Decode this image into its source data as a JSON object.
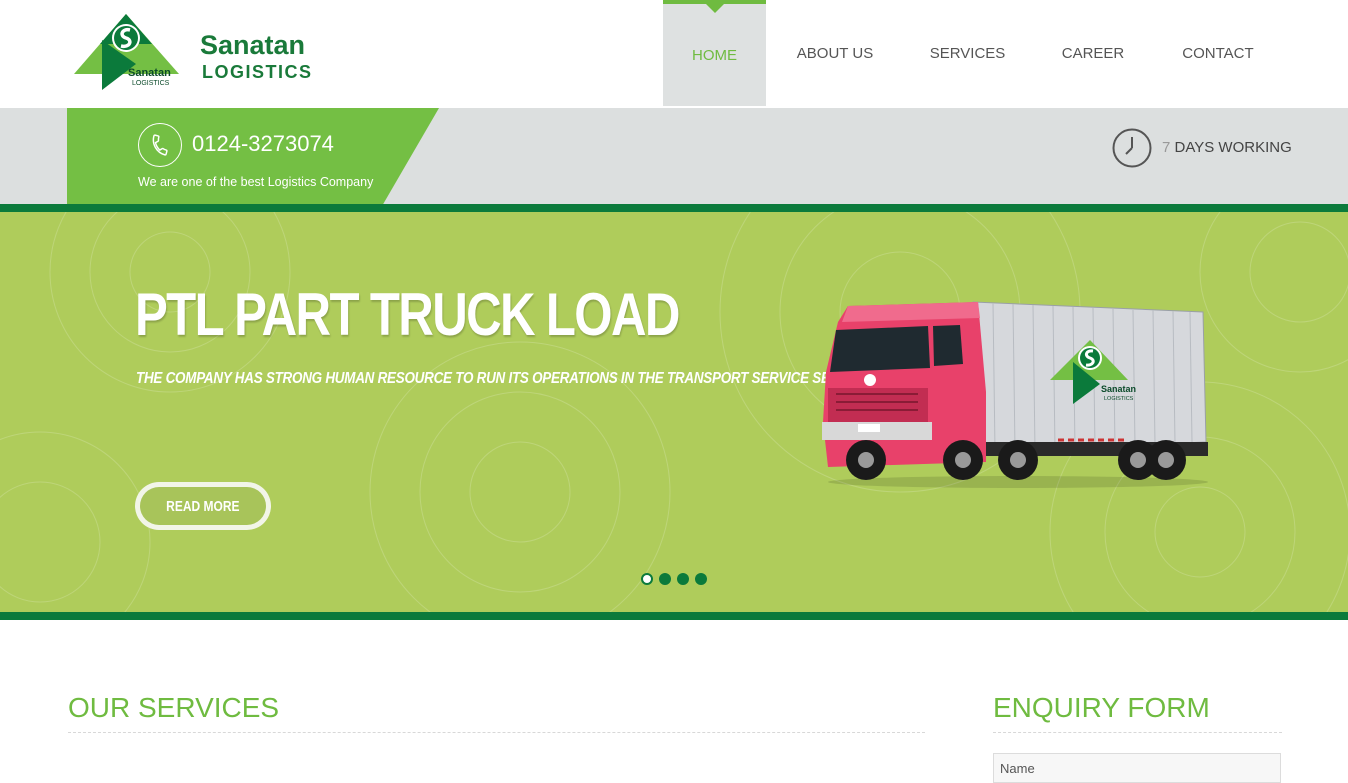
{
  "brand": {
    "name": "Sanatan",
    "sub": "LOGISTICS",
    "emblem_name": "Sanatan",
    "emblem_sub": "LOGISTICS"
  },
  "nav": {
    "items": [
      {
        "label": "HOME",
        "active": true
      },
      {
        "label": "ABOUT US",
        "active": false
      },
      {
        "label": "SERVICES",
        "active": false
      },
      {
        "label": "CAREER",
        "active": false
      },
      {
        "label": "CONTACT",
        "active": false
      }
    ]
  },
  "infobar": {
    "phone": "0124-3273074",
    "tagline": "We are one of the best Logistics Company",
    "days_number": "7",
    "days_text": "DAYS WORKING",
    "phone_icon": "phone-icon",
    "clock_icon": "clock-icon"
  },
  "hero": {
    "title": "PTL PART TRUCK LOAD",
    "subtitle": "THE COMPANY HAS STRONG HUMAN RESOURCE TO RUN ITS OPERATIONS IN THE TRANSPORT SERVICE SECTOR.",
    "button": "READ MORE",
    "slide_count": 4,
    "active_slide": 1,
    "truck_logo_name": "Sanatan",
    "truck_logo_sub": "LOGISTICS"
  },
  "sections": {
    "services_title": "OUR SERVICES",
    "enquiry_title": "ENQUIRY FORM",
    "name_placeholder": "Name"
  },
  "colors": {
    "primary_green": "#74bf44",
    "dark_green": "#0b7a3b",
    "hero_bg": "#afcc5b",
    "infobar_bg": "#dcdfdf"
  }
}
